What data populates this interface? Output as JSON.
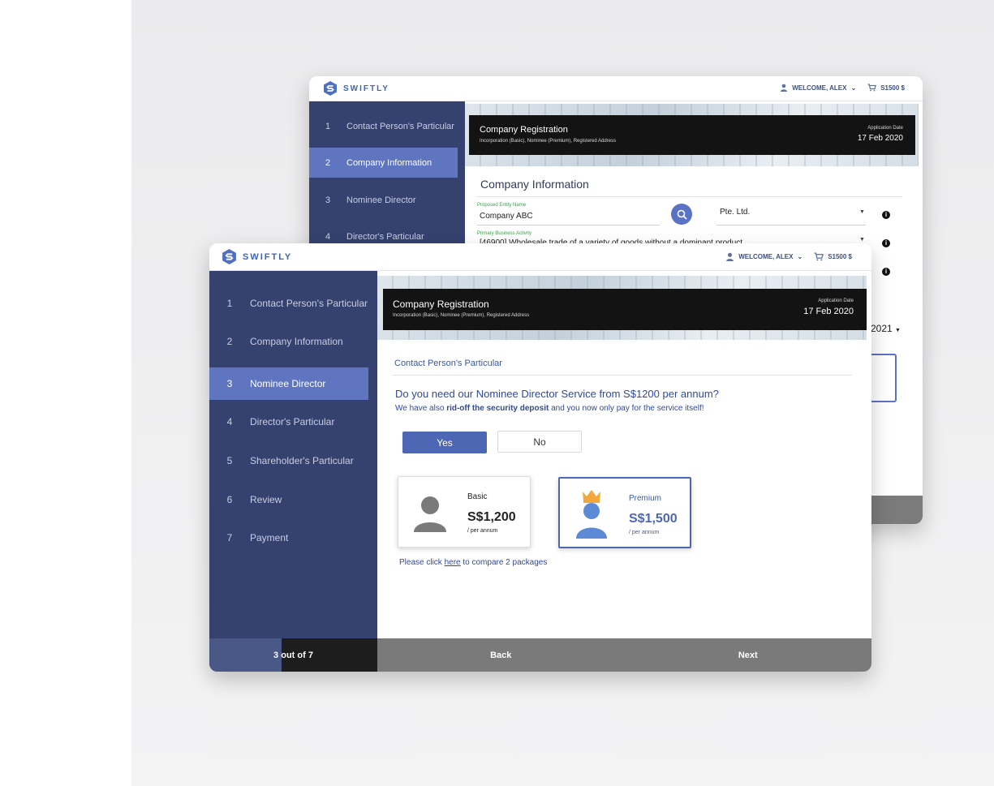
{
  "brand": {
    "name": "SWIFTLY",
    "accent": "#3f63b7",
    "sidebar_bg": "#35426f",
    "active_bg": "#5f75bf"
  },
  "header": {
    "welcome": "WELCOME, ALEX",
    "cart": "S1500 $"
  },
  "hero": {
    "title": "Company Registration",
    "subtitle": "Incorporation (Basic), Nominee (Premium), Registered Address",
    "date_label": "Application Date",
    "date_value": "17 Feb 2020"
  },
  "back_window": {
    "steps": [
      {
        "num": "1",
        "label": "Contact Person's Particular"
      },
      {
        "num": "2",
        "label": "Company Information"
      },
      {
        "num": "3",
        "label": "Nominee Director"
      },
      {
        "num": "4",
        "label": "Director's Particular"
      }
    ],
    "section_title": "Company Information",
    "entity_label": "Proposed Entity Name",
    "entity_value": "Company ABC",
    "entity_type": "Pte. Ltd.",
    "activity_label": "Primary Business Activity",
    "activity_value": "[46900]  Wholesale trade of a variety of goods without a dominant product",
    "date_fragment": "2021"
  },
  "front_window": {
    "steps": [
      {
        "num": "1",
        "label": "Contact Person's Particular"
      },
      {
        "num": "2",
        "label": "Company Information"
      },
      {
        "num": "3",
        "label": "Nominee Director"
      },
      {
        "num": "4",
        "label": "Director's Particular"
      },
      {
        "num": "5",
        "label": "Shareholder's Particular"
      },
      {
        "num": "6",
        "label": "Review"
      },
      {
        "num": "7",
        "label": "Payment"
      }
    ],
    "breadcrumb": "Contact Person's Particular",
    "question": "Do you need our Nominee Director Service from S$1200 per annum?",
    "subtext_pre": "We have also ",
    "subtext_bold": "rid-off the security deposit",
    "subtext_post": " and you now only pay for the service itself!",
    "yes_label": "Yes",
    "no_label": "No",
    "plans": [
      {
        "name": "Basic",
        "price": "S$1,200",
        "per": "/ per annum",
        "icon": "user-icon"
      },
      {
        "name": "Premium",
        "price": "S$1,500",
        "per": "/ per annum",
        "icon": "crowned-user-icon"
      }
    ],
    "compare_pre": "Please click ",
    "compare_link": "here",
    "compare_post": " to compare 2 packages",
    "footer": {
      "progress": "3 out of 7",
      "progress_fraction": 0.43,
      "back": "Back",
      "next": "Next"
    }
  }
}
